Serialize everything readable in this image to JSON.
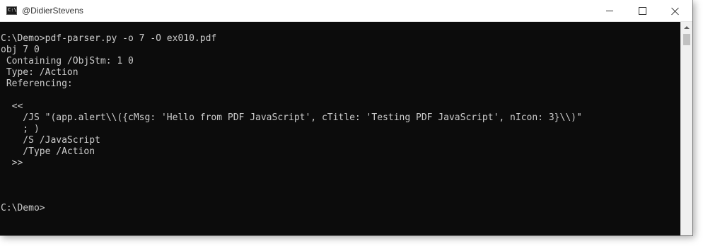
{
  "window": {
    "title": "@DidierStevens",
    "icon": "command-prompt-icon"
  },
  "caption_buttons": {
    "minimize": "minimize-icon",
    "maximize": "maximize-icon",
    "close": "close-icon"
  },
  "console": {
    "text": "C:\\Demo>pdf-parser.py -o 7 -O ex010.pdf\nobj 7 0\n Containing /ObjStm: 1 0\n Type: /Action\n Referencing:\n\n  <<\n    /JS \"(app.alert\\\\({cMsg: 'Hello from PDF JavaScript', cTitle: 'Testing PDF JavaScript', nIcon: 3}\\\\)\"\n    ; )\n    /S /JavaScript\n    /Type /Action\n  >>\n\n\n\nC:\\Demo>"
  },
  "colors": {
    "console_background": "#0c0c0c",
    "console_text": "#cccccc",
    "titlebar_background": "#ffffff"
  }
}
